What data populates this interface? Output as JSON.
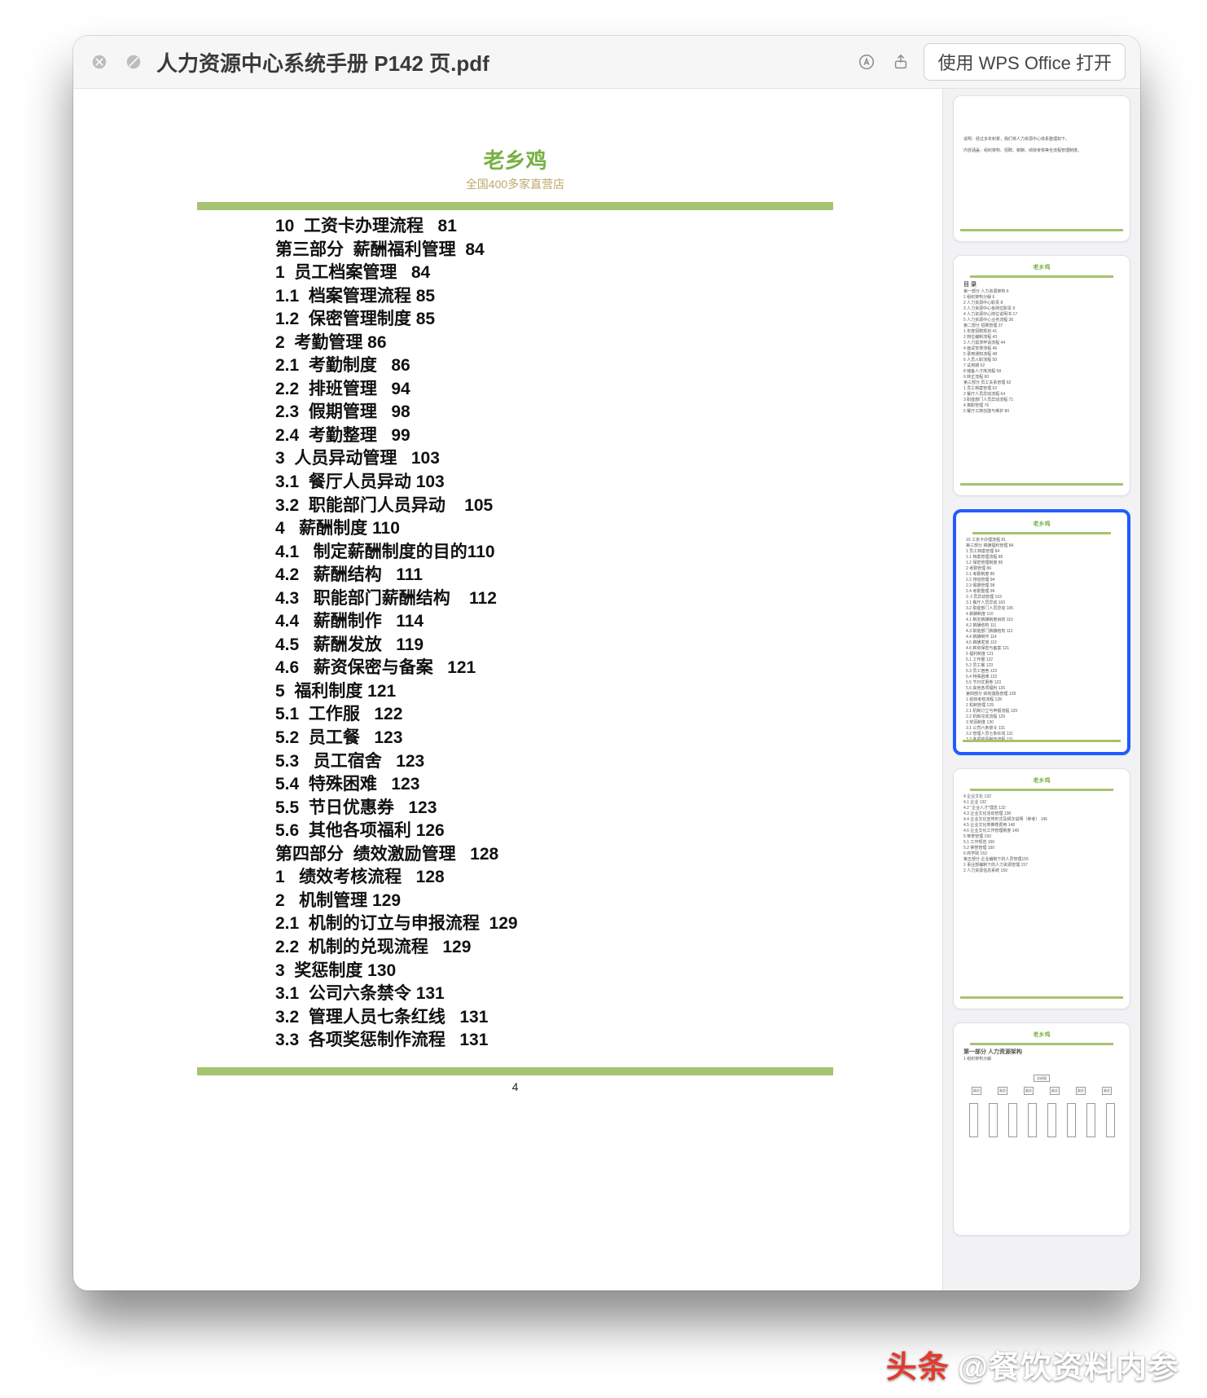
{
  "toolbar": {
    "title": "人力资源中心系统手册 P142 页.pdf",
    "open_label": "使用 WPS Office 打开"
  },
  "doc": {
    "title": "老乡鸡",
    "subtitle": "全国400多家直营店",
    "page_number": "4"
  },
  "toc": [
    "10  工资卡办理流程   81",
    "第三部分  薪酬福利管理  84",
    "1  员工档案管理   84",
    "1.1  档案管理流程 85",
    "1.2  保密管理制度 85",
    "2  考勤管理 86",
    "2.1  考勤制度   86",
    "2.2  排班管理   94",
    "2.3  假期管理   98",
    "2.4  考勤整理   99",
    "3  人员异动管理   103",
    "3.1  餐厅人员异动 103",
    "3.2  职能部门人员异动    105",
    "4   薪酬制度 110",
    "4.1   制定薪酬制度的目的110",
    "4.2   薪酬结构   111",
    "4.3   职能部门薪酬结构    112",
    "4.4   薪酬制作   114",
    "4.5   薪酬发放   119",
    "4.6   薪资保密与备案   121",
    "5  福利制度 121",
    "5.1  工作服   122",
    "5.2  员工餐   123",
    "5.3   员工宿舍   123",
    "5.4  特殊困难   123",
    "5.5  节日优惠券   123",
    "5.6  其他各项福利 126",
    "第四部分  绩效激励管理   128",
    "1   绩效考核流程   128",
    "2   机制管理 129",
    "2.1  机制的订立与申报流程  129",
    "2.2  机制的兑现流程   129",
    "3  奖惩制度 130",
    "3.1  公司六条禁令 131",
    "3.2  管理人员七条红线   131",
    "3.3  各项奖惩制作流程   131"
  ],
  "watermark": {
    "brand": "头条",
    "handle": "@餐饮资料内参"
  },
  "thumbnails": {
    "selected_index": 2
  }
}
